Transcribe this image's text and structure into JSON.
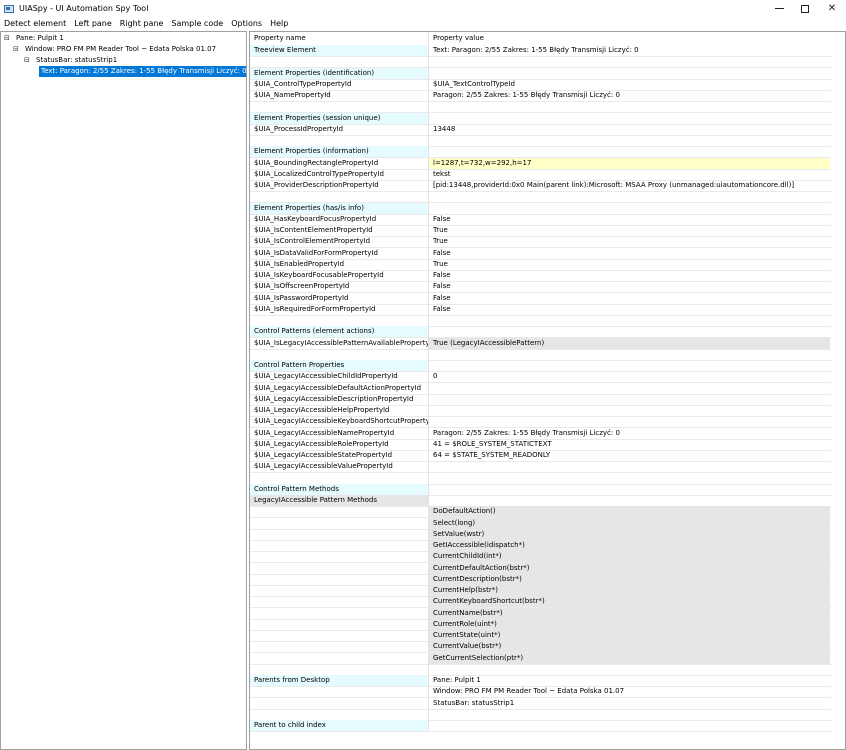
{
  "window": {
    "title": "UIASpy - UI Automation Spy Tool",
    "minimize_label": "",
    "maximize_label": "",
    "close_label": "✕"
  },
  "menu": [
    "Detect element",
    "Left pane",
    "Right pane",
    "Sample code",
    "Options",
    "Help"
  ],
  "tree": [
    {
      "label": "Pane: Pulpit 1",
      "toggle": "⊟",
      "level": 0,
      "selected": false
    },
    {
      "label": "Window: PRO FM  PM Reader Tool ~ Edata Polska 01.07",
      "toggle": "⊟",
      "level": 1,
      "selected": false
    },
    {
      "label": "StatusBar: statusStrip1",
      "toggle": "⊟",
      "level": 2,
      "selected": false
    },
    {
      "label": "Text: Paragon: 2/55   Zakres: 1-55   Błędy Transmisji Liczyć: 0",
      "toggle": "",
      "level": 3,
      "selected": true
    }
  ],
  "grid": {
    "col1_header": "Property name",
    "col2_header": "Property value",
    "rows": [
      {
        "name": "Treeview Element",
        "value": "Text: Paragon: 2/55   Zakres: 1-55   Błędy Transmisji Liczyć: 0",
        "style": "cyan"
      },
      {
        "name": "",
        "value": "",
        "style": "blank"
      },
      {
        "name": "Element Properties (identification)",
        "value": "",
        "style": "cyan"
      },
      {
        "name": "$UIA_ControlTypePropertyId",
        "value": "$UIA_TextControlTypeId",
        "style": ""
      },
      {
        "name": "$UIA_NamePropertyId",
        "value": "Paragon: 2/55   Zakres: 1-55   Błędy Transmisji Liczyć: 0",
        "style": ""
      },
      {
        "name": "",
        "value": "",
        "style": "blank"
      },
      {
        "name": "Element Properties (session unique)",
        "value": "",
        "style": "cyan"
      },
      {
        "name": "$UIA_ProcessIdPropertyId",
        "value": "13448",
        "style": ""
      },
      {
        "name": "",
        "value": "",
        "style": "blank"
      },
      {
        "name": "Element Properties (information)",
        "value": "",
        "style": "cyan"
      },
      {
        "name": "$UIA_BoundingRectanglePropertyId",
        "value": "l=1287,t=732,w=292,h=17",
        "style": "yellow"
      },
      {
        "name": "$UIA_LocalizedControlTypePropertyId",
        "value": "tekst",
        "style": ""
      },
      {
        "name": "$UIA_ProviderDescriptionPropertyId",
        "value": "[pid:13448,providerId:0x0 Main(parent link):Microsoft: MSAA Proxy (unmanaged:uiautomationcore.dll)]",
        "style": ""
      },
      {
        "name": "",
        "value": "",
        "style": "blank"
      },
      {
        "name": "Element Properties (has/is info)",
        "value": "",
        "style": "cyan"
      },
      {
        "name": "$UIA_HasKeyboardFocusPropertyId",
        "value": "False",
        "style": ""
      },
      {
        "name": "$UIA_IsContentElementPropertyId",
        "value": "True",
        "style": ""
      },
      {
        "name": "$UIA_IsControlElementPropertyId",
        "value": "True",
        "style": ""
      },
      {
        "name": "$UIA_IsDataValidForFormPropertyId",
        "value": "False",
        "style": ""
      },
      {
        "name": "$UIA_IsEnabledPropertyId",
        "value": "True",
        "style": ""
      },
      {
        "name": "$UIA_IsKeyboardFocusablePropertyId",
        "value": "False",
        "style": ""
      },
      {
        "name": "$UIA_IsOffscreenPropertyId",
        "value": "False",
        "style": ""
      },
      {
        "name": "$UIA_IsPasswordPropertyId",
        "value": "False",
        "style": ""
      },
      {
        "name": "$UIA_IsRequiredForFormPropertyId",
        "value": "False",
        "style": ""
      },
      {
        "name": "",
        "value": "",
        "style": "blank"
      },
      {
        "name": "Control Patterns (element actions)",
        "value": "",
        "style": "cyan"
      },
      {
        "name": "$UIA_IsLegacyIAccessiblePatternAvailablePropertyId",
        "value": "True (LegacyIAccessiblePattern)",
        "style": "gray"
      },
      {
        "name": "",
        "value": "",
        "style": "blank"
      },
      {
        "name": "Control Pattern Properties",
        "value": "",
        "style": "cyan"
      },
      {
        "name": "$UIA_LegacyIAccessibleChildIdPropertyId",
        "value": "0",
        "style": ""
      },
      {
        "name": "$UIA_LegacyIAccessibleDefaultActionPropertyId",
        "value": "",
        "style": ""
      },
      {
        "name": "$UIA_LegacyIAccessibleDescriptionPropertyId",
        "value": "",
        "style": ""
      },
      {
        "name": "$UIA_LegacyIAccessibleHelpPropertyId",
        "value": "",
        "style": ""
      },
      {
        "name": "$UIA_LegacyIAccessibleKeyboardShortcutPropertyId",
        "value": "",
        "style": ""
      },
      {
        "name": "$UIA_LegacyIAccessibleNamePropertyId",
        "value": "Paragon: 2/55   Zakres: 1-55   Błędy Transmisji Liczyć: 0",
        "style": ""
      },
      {
        "name": "$UIA_LegacyIAccessibleRolePropertyId",
        "value": "41 = $ROLE_SYSTEM_STATICTEXT",
        "style": ""
      },
      {
        "name": "$UIA_LegacyIAccessibleStatePropertyId",
        "value": "64 = $STATE_SYSTEM_READONLY",
        "style": ""
      },
      {
        "name": "$UIA_LegacyIAccessibleValuePropertyId",
        "value": "",
        "style": ""
      },
      {
        "name": "",
        "value": "",
        "style": "blank"
      },
      {
        "name": "Control Pattern Methods",
        "value": "",
        "style": "cyan"
      },
      {
        "name": "LegacyIAccessible Pattern Methods",
        "value": "",
        "style": "graylabel"
      },
      {
        "name": "",
        "value": "DoDefaultAction()",
        "style": "gray"
      },
      {
        "name": "",
        "value": "Select(long)",
        "style": "gray"
      },
      {
        "name": "",
        "value": "SetValue(wstr)",
        "style": "gray"
      },
      {
        "name": "",
        "value": "GetIAccessible(idispatch*)",
        "style": "gray"
      },
      {
        "name": "",
        "value": "CurrentChildId(int*)",
        "style": "gray"
      },
      {
        "name": "",
        "value": "CurrentDefaultAction(bstr*)",
        "style": "gray"
      },
      {
        "name": "",
        "value": "CurrentDescription(bstr*)",
        "style": "gray"
      },
      {
        "name": "",
        "value": "CurrentHelp(bstr*)",
        "style": "gray"
      },
      {
        "name": "",
        "value": "CurrentKeyboardShortcut(bstr*)",
        "style": "gray"
      },
      {
        "name": "",
        "value": "CurrentName(bstr*)",
        "style": "gray"
      },
      {
        "name": "",
        "value": "CurrentRole(uint*)",
        "style": "gray"
      },
      {
        "name": "",
        "value": "CurrentState(uint*)",
        "style": "gray"
      },
      {
        "name": "",
        "value": "CurrentValue(bstr*)",
        "style": "gray"
      },
      {
        "name": "",
        "value": "GetCurrentSelection(ptr*)",
        "style": "gray"
      },
      {
        "name": "",
        "value": "",
        "style": "blank"
      },
      {
        "name": "Parents from Desktop",
        "value": "Pane: Pulpit 1",
        "style": "cyan"
      },
      {
        "name": "",
        "value": "Window: PRO FM  PM Reader Tool ~ Edata Polska 01.07",
        "style": ""
      },
      {
        "name": "",
        "value": "StatusBar: statusStrip1",
        "style": ""
      },
      {
        "name": "",
        "value": "",
        "style": "blank"
      },
      {
        "name": "Parent to child index",
        "value": "",
        "style": "cyan"
      }
    ]
  },
  "colors": {
    "section_bg": "#e6fbff",
    "highlight_yellow": "#ffffc8",
    "method_gray": "#e6e6e6",
    "selection_blue": "#0078d7"
  }
}
